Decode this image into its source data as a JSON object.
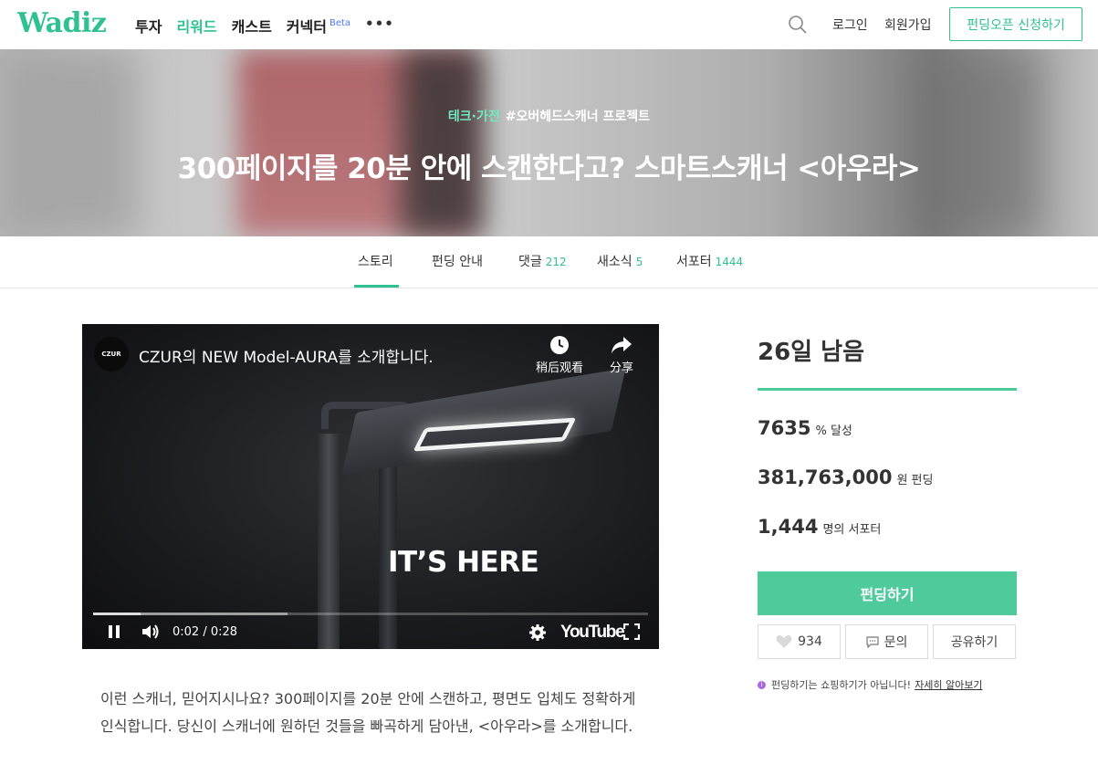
{
  "header": {
    "logo": "Wadiz",
    "nav": [
      {
        "label": "투자"
      },
      {
        "label": "리워드"
      },
      {
        "label": "캐스트"
      },
      {
        "label": "커넥터",
        "badge": "Beta"
      }
    ],
    "more_icon": "more-dots-icon",
    "search_icon": "search-icon",
    "login": "로그인",
    "signup": "회원가입",
    "open_button": "펀딩오픈 신청하기"
  },
  "hero": {
    "category": "테크·가전",
    "project_tag": "#오버헤드스캐너 프로젝트",
    "title": "300페이지를 20분 안에 스캔한다고? 스마트스캐너 <아우라>"
  },
  "tabs": [
    {
      "label": "스토리",
      "count": ""
    },
    {
      "label": "펀딩 안내",
      "count": ""
    },
    {
      "label": "댓글",
      "count": "212"
    },
    {
      "label": "새소식",
      "count": "5"
    },
    {
      "label": "서포터",
      "count": "1444"
    }
  ],
  "video": {
    "channel_logo": "CZUR",
    "title": "CZUR의 NEW Model-AURA를 소개합니다.",
    "watch_later": "稍后观看",
    "share": "分享",
    "overlay_text": "IT’S HERE",
    "time": "0:02 / 0:28",
    "progress_played": 0.085,
    "progress_buffered": 0.35,
    "brand": "YouTube"
  },
  "story": {
    "intro": "이런 스캐너, 믿어지시나요? 300페이지를 20분 안에 스캔하고, 평면도 입체도 정확하게 인식합니다. 당신이 스캐너에 원하던 것들을 빠곡하게 담아낸, <아우라>를 소개합니다."
  },
  "sidebar": {
    "days_left": "26일 남음",
    "progress_fill": 1.0,
    "percent": "7635",
    "percent_unit": "% 달성",
    "amount": "381,763,000",
    "amount_unit": "원 펀딩",
    "supporters": "1,444",
    "supporters_unit": "명의 서포터",
    "fund_button": "펀딩하기",
    "like_count": "934",
    "inquiry": "문의",
    "share": "공유하기",
    "notice": "펀딩하기는 쇼핑하기가 아닙니다!",
    "notice_link": "자세히 알아보기"
  },
  "colors": {
    "brand": "#2fc192",
    "button": "#4fca9a",
    "beta": "#4a78ff"
  }
}
